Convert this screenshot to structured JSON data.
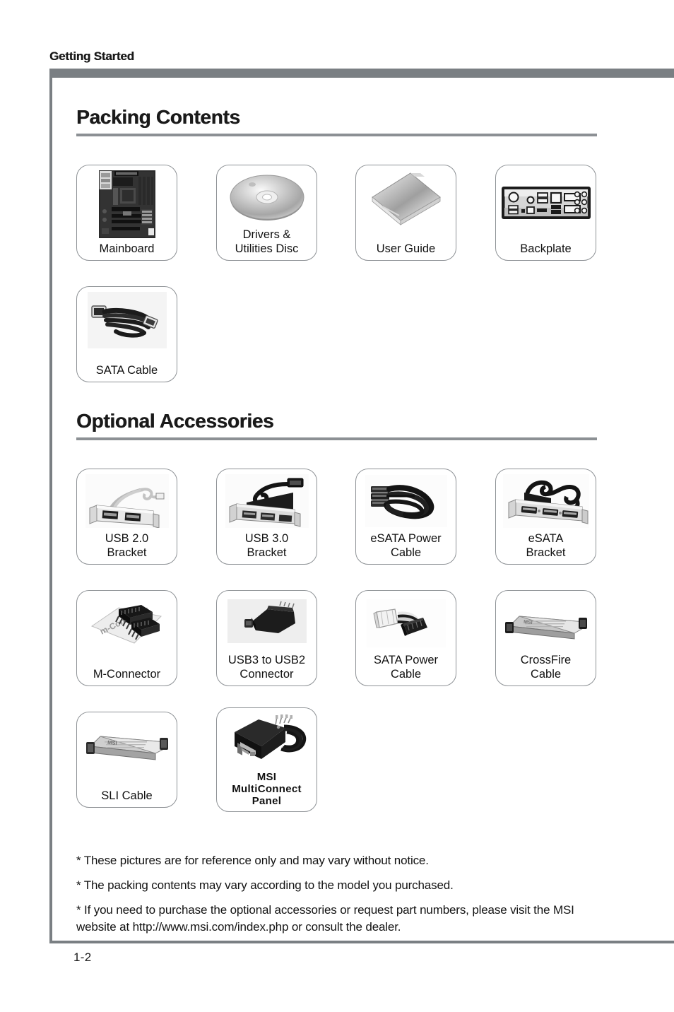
{
  "running_head": "Getting Started",
  "page_number": "1-2",
  "colors": {
    "rule": "#7a7f83",
    "heading_underline": "#8c9094",
    "box_border": "#8e9296",
    "text": "#1a1a1a"
  },
  "sections": [
    {
      "id": "packing-contents",
      "title": "Packing Contents",
      "items": [
        {
          "caption": "Mainboard",
          "icon": "mainboard-icon"
        },
        {
          "caption": "Drivers &\nUtilities Disc",
          "icon": "disc-icon"
        },
        {
          "caption": "User Guide",
          "icon": "user-guide-icon"
        },
        {
          "caption": "Backplate",
          "icon": "backplate-icon"
        },
        {
          "caption": "SATA Cable",
          "icon": "sata-cable-icon"
        }
      ]
    },
    {
      "id": "optional-accessories",
      "title": "Optional Accessories",
      "items": [
        {
          "caption": "USB 2.0\nBracket",
          "icon": "usb2-bracket-icon"
        },
        {
          "caption": "USB 3.0\nBracket",
          "icon": "usb3-bracket-icon"
        },
        {
          "caption": "eSATA Power\nCable",
          "icon": "esata-power-cable-icon"
        },
        {
          "caption": "eSATA\nBracket",
          "icon": "esata-bracket-icon"
        },
        {
          "caption": "M-Connector",
          "icon": "m-connector-icon"
        },
        {
          "caption": "USB3 to USB2\nConnector",
          "icon": "usb3-to-usb2-connector-icon"
        },
        {
          "caption": "SATA Power\nCable",
          "icon": "sata-power-cable-icon"
        },
        {
          "caption": "CrossFire\nCable",
          "icon": "crossfire-cable-icon"
        },
        {
          "caption": "SLI Cable",
          "icon": "sli-cable-icon"
        },
        {
          "caption": "MSI\nMultiConnect\nPanel",
          "icon": "msi-multiconnect-panel-icon"
        }
      ]
    }
  ],
  "notes": [
    "* These pictures are for reference only and may vary without notice.",
    "* The packing contents may vary according to the model you purchased.",
    "* If you need to purchase the optional accessories or request part numbers, please visit the MSI website at http://www.msi.com/index.php or consult the dealer."
  ]
}
